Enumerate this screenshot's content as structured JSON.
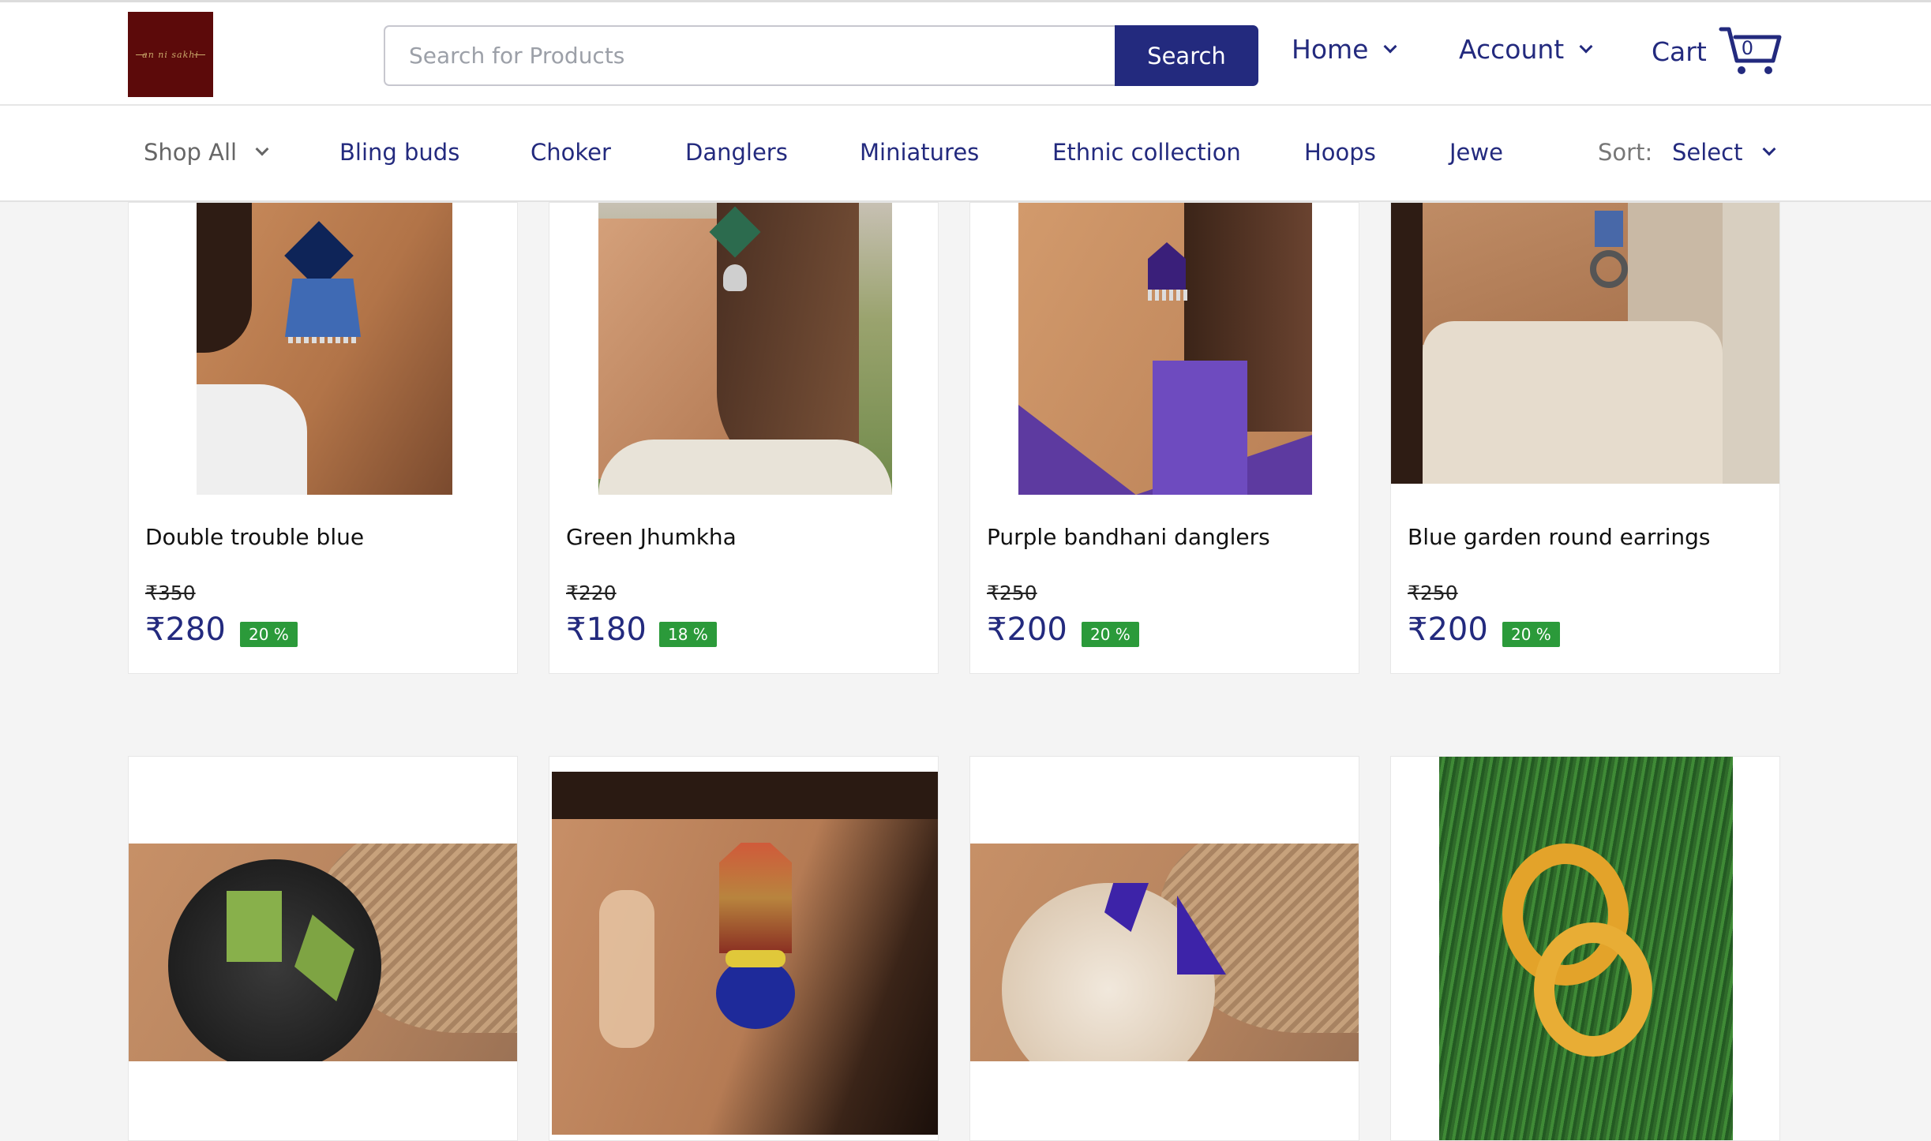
{
  "header": {
    "logo_text": "an ni sakhi",
    "search_placeholder": "Search for Products",
    "search_button": "Search",
    "home_label": "Home",
    "account_label": "Account",
    "cart_label": "Cart",
    "cart_count": "0"
  },
  "categories": {
    "shop_all": "Shop All",
    "items": [
      "Bling buds",
      "Choker",
      "Danglers",
      "Miniatures",
      "Ethnic collection",
      "Hoops",
      "Jewe"
    ],
    "sort_label": "Sort:",
    "sort_value": "Select"
  },
  "products": [
    {
      "name": "Double trouble blue",
      "mrp": "₹350",
      "price": "₹280",
      "discount": "20 %"
    },
    {
      "name": "Green Jhumkha",
      "mrp": "₹220",
      "price": "₹180",
      "discount": "18 %"
    },
    {
      "name": "Purple bandhani danglers",
      "mrp": "₹250",
      "price": "₹200",
      "discount": "20 %"
    },
    {
      "name": "Blue garden round earrings",
      "mrp": "₹250",
      "price": "₹200",
      "discount": "20 %"
    }
  ],
  "colors": {
    "brand_navy": "#232a7e",
    "discount_green": "#2b9a3a",
    "logo_maroon": "#5c0a0a"
  }
}
